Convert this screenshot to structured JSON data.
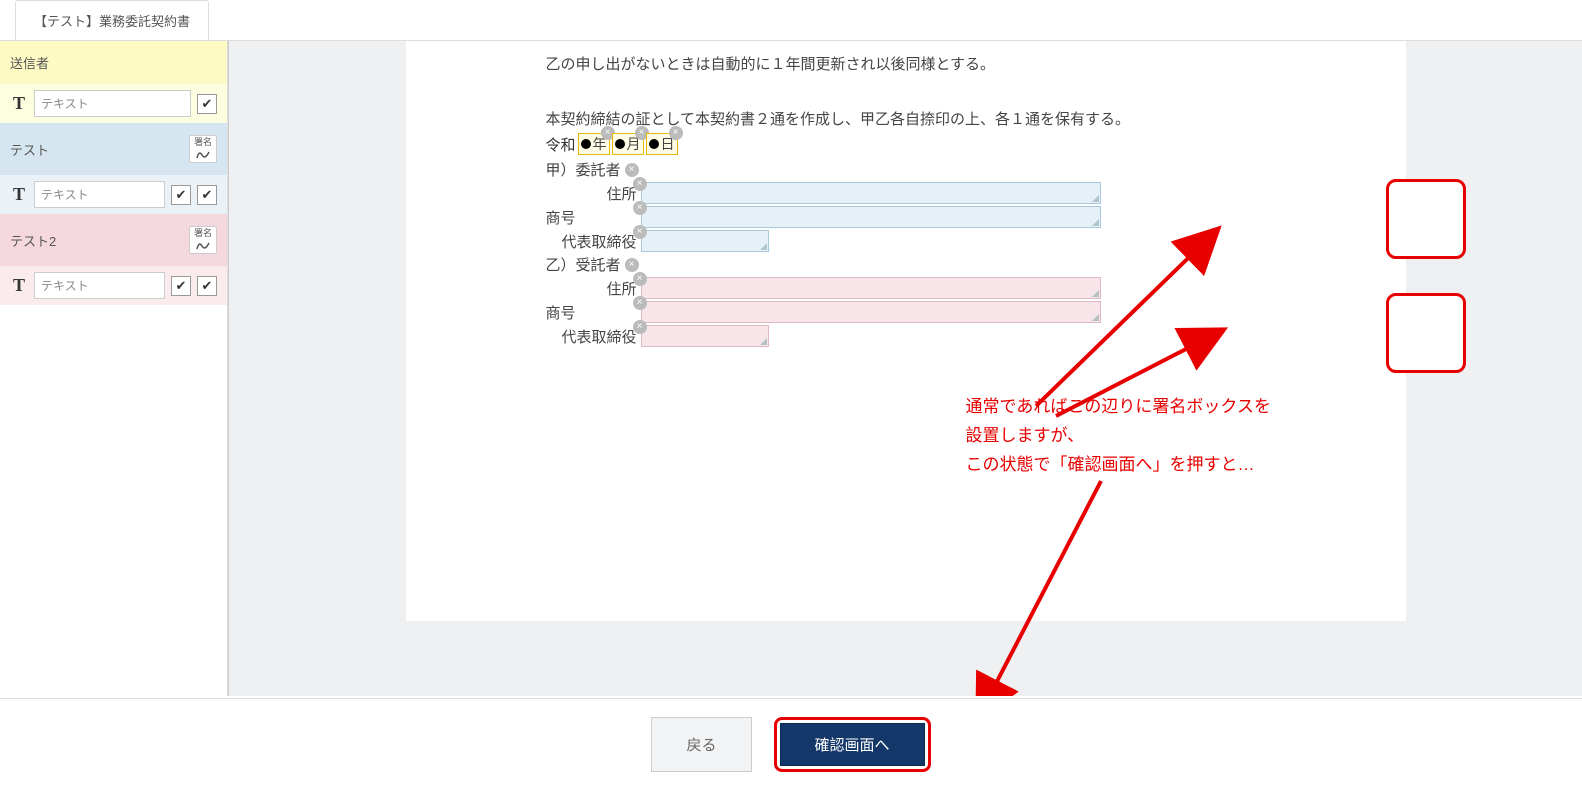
{
  "tab": {
    "title": "【テスト】業務委託契約書"
  },
  "sidebar": {
    "sections": [
      {
        "title": "送信者",
        "sign_label": "",
        "fields": [
          {
            "label": "テキスト",
            "checks": [
              true
            ]
          }
        ]
      },
      {
        "title": "テスト",
        "sign_label": "署名",
        "fields": [
          {
            "label": "テキスト",
            "checks": [
              true,
              true
            ]
          }
        ]
      },
      {
        "title": "テスト2",
        "sign_label": "署名",
        "fields": [
          {
            "label": "テキスト",
            "checks": [
              true,
              true
            ]
          }
        ]
      }
    ]
  },
  "document": {
    "line1": "乙の申し出がないときは自動的に１年間更新され以後同様とする。",
    "line2": "本契約締結の証として本契約書２通を作成し、甲乙各自捺印の上、各１通を保有する。",
    "date": {
      "era": "令和",
      "year_unit": "年",
      "month_unit": "月",
      "day_unit": "日"
    },
    "party1": {
      "heading": "甲）委託者",
      "addr": "住所",
      "name": "商号",
      "rep": "代表取締役"
    },
    "party2": {
      "heading": "乙）受託者",
      "addr": "住所",
      "name": "商号",
      "rep": "代表取締役"
    }
  },
  "annotation": {
    "line1": "通常であればこの辺りに署名ボックスを",
    "line2": "設置しますが、",
    "line3": "この状態で「確認画面へ」を押すと…"
  },
  "footer": {
    "back": "戻る",
    "confirm": "確認画面へ"
  },
  "colors": {
    "red": "#e80000",
    "navy": "#143869"
  }
}
